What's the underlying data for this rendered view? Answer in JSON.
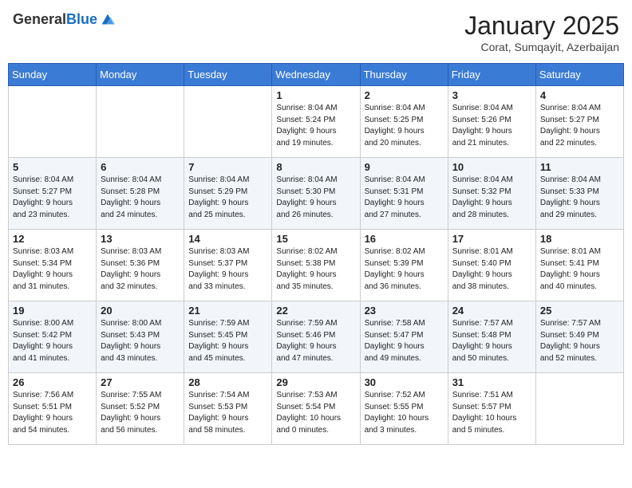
{
  "header": {
    "logo_general": "General",
    "logo_blue": "Blue",
    "month_title": "January 2025",
    "location": "Corat, Sumqayit, Azerbaijan"
  },
  "weekdays": [
    "Sunday",
    "Monday",
    "Tuesday",
    "Wednesday",
    "Thursday",
    "Friday",
    "Saturday"
  ],
  "weeks": [
    [
      {
        "day": "",
        "info": ""
      },
      {
        "day": "",
        "info": ""
      },
      {
        "day": "",
        "info": ""
      },
      {
        "day": "1",
        "info": "Sunrise: 8:04 AM\nSunset: 5:24 PM\nDaylight: 9 hours\nand 19 minutes."
      },
      {
        "day": "2",
        "info": "Sunrise: 8:04 AM\nSunset: 5:25 PM\nDaylight: 9 hours\nand 20 minutes."
      },
      {
        "day": "3",
        "info": "Sunrise: 8:04 AM\nSunset: 5:26 PM\nDaylight: 9 hours\nand 21 minutes."
      },
      {
        "day": "4",
        "info": "Sunrise: 8:04 AM\nSunset: 5:27 PM\nDaylight: 9 hours\nand 22 minutes."
      }
    ],
    [
      {
        "day": "5",
        "info": "Sunrise: 8:04 AM\nSunset: 5:27 PM\nDaylight: 9 hours\nand 23 minutes."
      },
      {
        "day": "6",
        "info": "Sunrise: 8:04 AM\nSunset: 5:28 PM\nDaylight: 9 hours\nand 24 minutes."
      },
      {
        "day": "7",
        "info": "Sunrise: 8:04 AM\nSunset: 5:29 PM\nDaylight: 9 hours\nand 25 minutes."
      },
      {
        "day": "8",
        "info": "Sunrise: 8:04 AM\nSunset: 5:30 PM\nDaylight: 9 hours\nand 26 minutes."
      },
      {
        "day": "9",
        "info": "Sunrise: 8:04 AM\nSunset: 5:31 PM\nDaylight: 9 hours\nand 27 minutes."
      },
      {
        "day": "10",
        "info": "Sunrise: 8:04 AM\nSunset: 5:32 PM\nDaylight: 9 hours\nand 28 minutes."
      },
      {
        "day": "11",
        "info": "Sunrise: 8:04 AM\nSunset: 5:33 PM\nDaylight: 9 hours\nand 29 minutes."
      }
    ],
    [
      {
        "day": "12",
        "info": "Sunrise: 8:03 AM\nSunset: 5:34 PM\nDaylight: 9 hours\nand 31 minutes."
      },
      {
        "day": "13",
        "info": "Sunrise: 8:03 AM\nSunset: 5:36 PM\nDaylight: 9 hours\nand 32 minutes."
      },
      {
        "day": "14",
        "info": "Sunrise: 8:03 AM\nSunset: 5:37 PM\nDaylight: 9 hours\nand 33 minutes."
      },
      {
        "day": "15",
        "info": "Sunrise: 8:02 AM\nSunset: 5:38 PM\nDaylight: 9 hours\nand 35 minutes."
      },
      {
        "day": "16",
        "info": "Sunrise: 8:02 AM\nSunset: 5:39 PM\nDaylight: 9 hours\nand 36 minutes."
      },
      {
        "day": "17",
        "info": "Sunrise: 8:01 AM\nSunset: 5:40 PM\nDaylight: 9 hours\nand 38 minutes."
      },
      {
        "day": "18",
        "info": "Sunrise: 8:01 AM\nSunset: 5:41 PM\nDaylight: 9 hours\nand 40 minutes."
      }
    ],
    [
      {
        "day": "19",
        "info": "Sunrise: 8:00 AM\nSunset: 5:42 PM\nDaylight: 9 hours\nand 41 minutes."
      },
      {
        "day": "20",
        "info": "Sunrise: 8:00 AM\nSunset: 5:43 PM\nDaylight: 9 hours\nand 43 minutes."
      },
      {
        "day": "21",
        "info": "Sunrise: 7:59 AM\nSunset: 5:45 PM\nDaylight: 9 hours\nand 45 minutes."
      },
      {
        "day": "22",
        "info": "Sunrise: 7:59 AM\nSunset: 5:46 PM\nDaylight: 9 hours\nand 47 minutes."
      },
      {
        "day": "23",
        "info": "Sunrise: 7:58 AM\nSunset: 5:47 PM\nDaylight: 9 hours\nand 49 minutes."
      },
      {
        "day": "24",
        "info": "Sunrise: 7:57 AM\nSunset: 5:48 PM\nDaylight: 9 hours\nand 50 minutes."
      },
      {
        "day": "25",
        "info": "Sunrise: 7:57 AM\nSunset: 5:49 PM\nDaylight: 9 hours\nand 52 minutes."
      }
    ],
    [
      {
        "day": "26",
        "info": "Sunrise: 7:56 AM\nSunset: 5:51 PM\nDaylight: 9 hours\nand 54 minutes."
      },
      {
        "day": "27",
        "info": "Sunrise: 7:55 AM\nSunset: 5:52 PM\nDaylight: 9 hours\nand 56 minutes."
      },
      {
        "day": "28",
        "info": "Sunrise: 7:54 AM\nSunset: 5:53 PM\nDaylight: 9 hours\nand 58 minutes."
      },
      {
        "day": "29",
        "info": "Sunrise: 7:53 AM\nSunset: 5:54 PM\nDaylight: 10 hours\nand 0 minutes."
      },
      {
        "day": "30",
        "info": "Sunrise: 7:52 AM\nSunset: 5:55 PM\nDaylight: 10 hours\nand 3 minutes."
      },
      {
        "day": "31",
        "info": "Sunrise: 7:51 AM\nSunset: 5:57 PM\nDaylight: 10 hours\nand 5 minutes."
      },
      {
        "day": "",
        "info": ""
      }
    ]
  ]
}
